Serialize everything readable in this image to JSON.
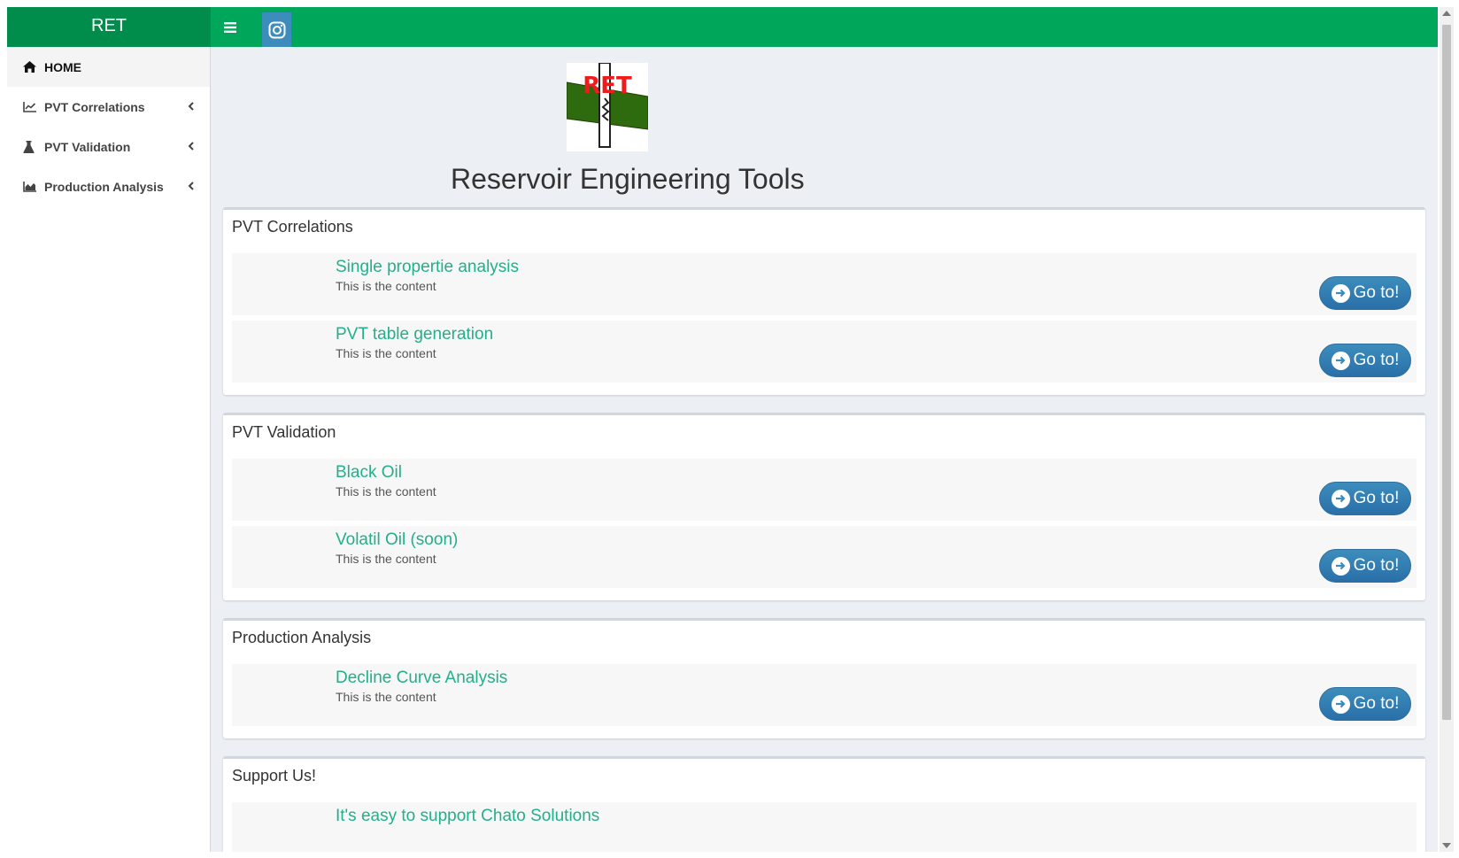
{
  "header": {
    "brand": "RET",
    "toggle_icon": "hamburger-icon",
    "instagram_icon": "instagram-icon",
    "accent_color": "#00a65a"
  },
  "sidebar": {
    "items": [
      {
        "label": "HOME",
        "icon": "home-icon"
      },
      {
        "label": "PVT Correlations",
        "icon": "line-chart-icon"
      },
      {
        "label": "PVT Validation",
        "icon": "flask-icon"
      },
      {
        "label": "Production Analysis",
        "icon": "area-chart-icon"
      }
    ]
  },
  "main": {
    "logo_text": "RET",
    "title": "Reservoir Engineering Tools",
    "sections": [
      {
        "title": "PVT Correlations",
        "items": [
          {
            "title": "Single propertie analysis",
            "desc": "This is the content",
            "button": "Go to!"
          },
          {
            "title": "PVT table generation",
            "desc": "This is the content",
            "button": "Go to!"
          }
        ]
      },
      {
        "title": "PVT Validation",
        "items": [
          {
            "title": "Black Oil",
            "desc": "This is the content",
            "button": "Go to!"
          },
          {
            "title": "Volatil Oil (soon)",
            "desc": "This is the content",
            "button": "Go to!"
          }
        ]
      },
      {
        "title": "Production Analysis",
        "items": [
          {
            "title": "Decline Curve Analysis",
            "desc": "This is the content",
            "button": "Go to!"
          }
        ]
      },
      {
        "title": "Support Us!",
        "items": [
          {
            "title": "It's easy to support Chato Solutions"
          }
        ]
      }
    ]
  }
}
